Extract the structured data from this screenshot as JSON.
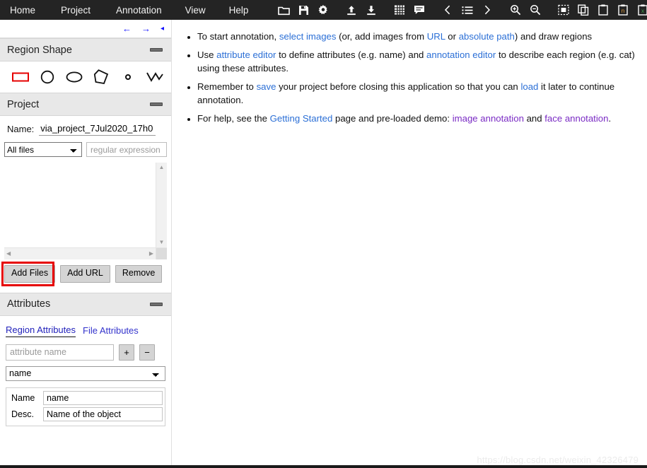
{
  "menubar": {
    "items": [
      {
        "label": "Home",
        "name": "menu-home"
      },
      {
        "label": "Project",
        "name": "menu-project"
      },
      {
        "label": "Annotation",
        "name": "menu-annotation"
      },
      {
        "label": "View",
        "name": "menu-view"
      },
      {
        "label": "Help",
        "name": "menu-help"
      }
    ],
    "tools": [
      {
        "icon": "folder-open-icon"
      },
      {
        "icon": "save-floppy-icon"
      },
      {
        "icon": "gear-icon"
      },
      {
        "icon": "upload-icon"
      },
      {
        "icon": "download-icon"
      },
      {
        "icon": "grid-icon"
      },
      {
        "icon": "comment-icon"
      },
      {
        "icon": "chevron-left-icon"
      },
      {
        "icon": "list-icon"
      },
      {
        "icon": "chevron-right-icon"
      },
      {
        "icon": "zoom-in-icon"
      },
      {
        "icon": "zoom-out-icon"
      },
      {
        "icon": "select-region-icon"
      },
      {
        "icon": "copy-icon"
      },
      {
        "icon": "clipboard-icon"
      },
      {
        "icon": "clipboard-n-icon"
      },
      {
        "icon": "clipboard-x-icon"
      },
      {
        "icon": "close-icon"
      }
    ]
  },
  "nav": {
    "prev": "←",
    "next": "→",
    "collapse": "◂"
  },
  "region_shape": {
    "title": "Region Shape",
    "shapes": [
      {
        "name": "shape-rectangle-icon",
        "selected": true
      },
      {
        "name": "shape-circle-icon",
        "selected": false
      },
      {
        "name": "shape-ellipse-icon",
        "selected": false
      },
      {
        "name": "shape-polygon-icon",
        "selected": false
      },
      {
        "name": "shape-point-icon",
        "selected": false
      },
      {
        "name": "shape-polyline-icon",
        "selected": false
      }
    ]
  },
  "project": {
    "title": "Project",
    "name_label": "Name:",
    "name_value": "via_project_7Jul2020_17h0",
    "file_filter_selected": "All files",
    "file_filter_options": [
      "All files"
    ],
    "regex_placeholder": "regular expression",
    "regex_value": "",
    "files": [],
    "buttons": {
      "add_files": "Add Files",
      "add_url": "Add URL",
      "remove": "Remove"
    }
  },
  "attributes": {
    "title": "Attributes",
    "tabs": [
      {
        "label": "Region Attributes",
        "active": true
      },
      {
        "label": "File Attributes",
        "active": false
      }
    ],
    "attribute_name_placeholder": "attribute name",
    "attribute_name_value": "",
    "add_label": "+",
    "remove_label": "−",
    "selected_attribute": "name",
    "attribute_options": [
      "name"
    ],
    "detail_rows": [
      {
        "key": "Name",
        "value": "name"
      },
      {
        "key": "Desc.",
        "value": "Name of the object"
      }
    ]
  },
  "content": {
    "bullets": [
      [
        {
          "t": "To start annotation, ",
          "s": "plain"
        },
        {
          "t": "select images",
          "s": "link"
        },
        {
          "t": " (or, add images from ",
          "s": "plain"
        },
        {
          "t": "URL",
          "s": "link"
        },
        {
          "t": " or ",
          "s": "plain"
        },
        {
          "t": "absolute path",
          "s": "link"
        },
        {
          "t": ") and draw regions",
          "s": "plain"
        }
      ],
      [
        {
          "t": "Use ",
          "s": "plain"
        },
        {
          "t": "attribute editor",
          "s": "link"
        },
        {
          "t": " to define attributes (e.g. name) and ",
          "s": "plain"
        },
        {
          "t": "annotation editor",
          "s": "link"
        },
        {
          "t": " to describe each region (e.g. cat) using these attributes.",
          "s": "plain"
        }
      ],
      [
        {
          "t": "Remember to ",
          "s": "plain"
        },
        {
          "t": "save",
          "s": "link"
        },
        {
          "t": " your project before closing this application so that you can ",
          "s": "plain"
        },
        {
          "t": "load",
          "s": "link"
        },
        {
          "t": " it later to continue annotation.",
          "s": "plain"
        }
      ],
      [
        {
          "t": "For help, see the ",
          "s": "plain"
        },
        {
          "t": "Getting Started",
          "s": "link"
        },
        {
          "t": " page and pre-loaded demo: ",
          "s": "plain"
        },
        {
          "t": "image annotation",
          "s": "link-purple"
        },
        {
          "t": " and ",
          "s": "plain"
        },
        {
          "t": "face annotation",
          "s": "link-purple"
        },
        {
          "t": ".",
          "s": "plain"
        }
      ]
    ],
    "watermark": "https://blog.csdn.net/weixin_42326479"
  },
  "colors": {
    "topbar_bg": "#242424",
    "selected_shape": "#e60000",
    "highlight_box": "#e60000",
    "link": "#2b6fd6",
    "link_purple": "#7a2bc4",
    "section_header_bg": "#e8e8e8"
  }
}
